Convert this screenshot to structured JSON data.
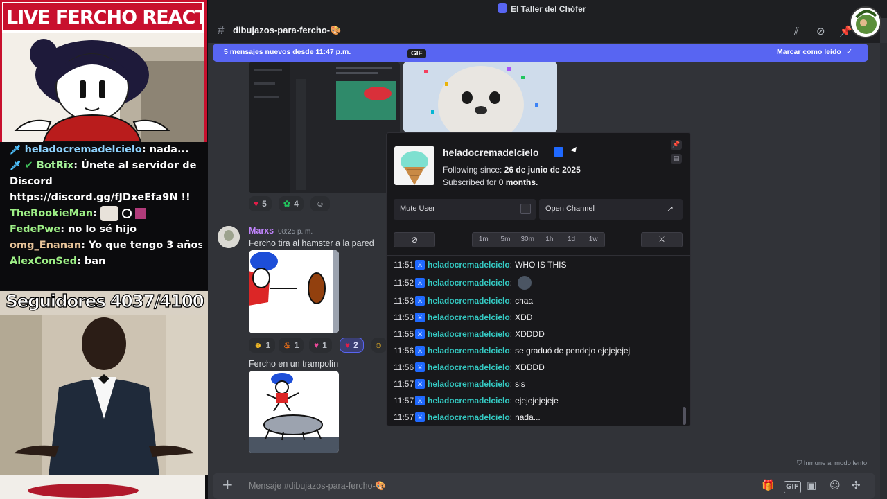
{
  "overlay": {
    "banner": "LIVE FERCHO REACTION",
    "chat": [
      {
        "icon": "sword-icon",
        "user": "heladocremadelcielo",
        "text": "nada...",
        "user_color": "#8fd4ff"
      },
      {
        "icon": "sword-icon",
        "verified": true,
        "user": "BotRix",
        "text": "Únete al servidor de Discord https://discord.gg/fJDxeEfa9N !!",
        "user_color": "#a6f59a"
      },
      {
        "user": "TheRookieMan",
        "text": "",
        "user_color": "#9ef086"
      },
      {
        "user": "FedePwe",
        "text": "no lo sé hijo",
        "user_color": "#9ef086"
      },
      {
        "user": "omg_Enanan",
        "text": "Yo que tengo 3 años",
        "user_color": "#e9c59a"
      },
      {
        "user": "AlexConSed",
        "text": "ban",
        "user_color": "#9ef086"
      }
    ],
    "followers": "Seguidores 4037/4100"
  },
  "titlebar": {
    "server_name": "El Taller del Chófer"
  },
  "channel": {
    "name": "dibujazos-para-fercho-🎨"
  },
  "new_messages": {
    "text": "5 mensajes nuevos desde 11:47 p.m.",
    "action": "Marcar como leído"
  },
  "messages": {
    "gif_badge": "GIF",
    "reactions_top": [
      {
        "emoji": "❤️",
        "count": "5"
      },
      {
        "emoji": "🌿",
        "count": "4"
      },
      {
        "emoji": "🙂",
        "count": ""
      }
    ],
    "marxs": {
      "author": "Marxs",
      "time": "08:25 p. m.",
      "text": "Fercho tira al hamster a la pared",
      "author_color": "#c084fc"
    },
    "reactions_mid": [
      {
        "emoji": "😝",
        "count": "1"
      },
      {
        "emoji": "🔥",
        "count": "1"
      },
      {
        "emoji": "💖",
        "count": "1"
      },
      {
        "emoji": "❤️",
        "count": "2",
        "active": true
      },
      {
        "emoji": "😺",
        "count": ""
      }
    ],
    "trampoline_text": "Fercho en un trampolín",
    "slowmode": "Inmune al modo lento"
  },
  "composer": {
    "placeholder": "Mensaje #dibujazos-para-fercho-🎨"
  },
  "usercard": {
    "username": "heladocremadelcielo",
    "following_label": "Following since:",
    "following_date": "26 de junio de 2025",
    "subscribed_label": "Subscribed for",
    "subscribed_value": "0 months.",
    "mute_label": "Mute User",
    "open_label": "Open Channel",
    "timeouts": [
      "1m",
      "5m",
      "30m",
      "1h",
      "1d",
      "1w"
    ],
    "log": [
      {
        "time": "11:51",
        "user": "heladocremadelcielo",
        "msg": "WHO IS THIS"
      },
      {
        "time": "11:52",
        "user": "heladocremadelcielo",
        "msg": "",
        "emote": true
      },
      {
        "time": "11:53",
        "user": "heladocremadelcielo",
        "msg": "chaa"
      },
      {
        "time": "11:53",
        "user": "heladocremadelcielo",
        "msg": "XDD"
      },
      {
        "time": "11:55",
        "user": "heladocremadelcielo",
        "msg": "XDDDD"
      },
      {
        "time": "11:56",
        "user": "heladocremadelcielo",
        "msg": "se graduó de pendejo ejejejejej"
      },
      {
        "time": "11:56",
        "user": "heladocremadelcielo",
        "msg": "XDDDD"
      },
      {
        "time": "11:57",
        "user": "heladocremadelcielo",
        "msg": "sis"
      },
      {
        "time": "11:57",
        "user": "heladocremadelcielo",
        "msg": "ejejejejejeje"
      },
      {
        "time": "11:57",
        "user": "heladocremadelcielo",
        "msg": "nada..."
      }
    ]
  }
}
